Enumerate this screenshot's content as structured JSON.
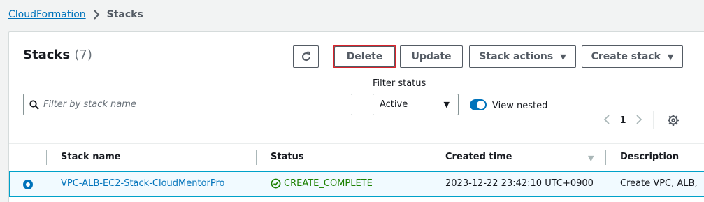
{
  "breadcrumb": {
    "parent": "CloudFormation",
    "current": "Stacks"
  },
  "panel": {
    "title": "Stacks",
    "count": "(7)"
  },
  "toolbar": {
    "delete_label": "Delete",
    "update_label": "Update",
    "stack_actions_label": "Stack actions",
    "create_stack_label": "Create stack"
  },
  "filter": {
    "placeholder": "Filter by stack name",
    "status_label": "Filter status",
    "status_value": "Active",
    "view_nested_label": "View nested",
    "view_nested_on": true
  },
  "pagination": {
    "current_page": "1"
  },
  "table": {
    "columns": [
      "Stack name",
      "Status",
      "Created time",
      "Description"
    ],
    "rows": [
      {
        "selected": true,
        "stack_name": "VPC-ALB-EC2-Stack-CloudMentorPro",
        "status": "CREATE_COMPLETE",
        "created_time": "2023-12-22 23:42:10 UTC+0900",
        "description": "Create VPC, ALB,"
      }
    ]
  },
  "colors": {
    "link": "#0073bb",
    "success": "#1d8102",
    "highlight": "#d9232b",
    "selected_row": "#f1faff"
  },
  "icons": [
    "chevron-right-icon",
    "refresh-icon",
    "caret-down-icon",
    "search-icon",
    "chevron-left-icon",
    "gear-icon",
    "sort-icon",
    "check-circle-icon"
  ]
}
